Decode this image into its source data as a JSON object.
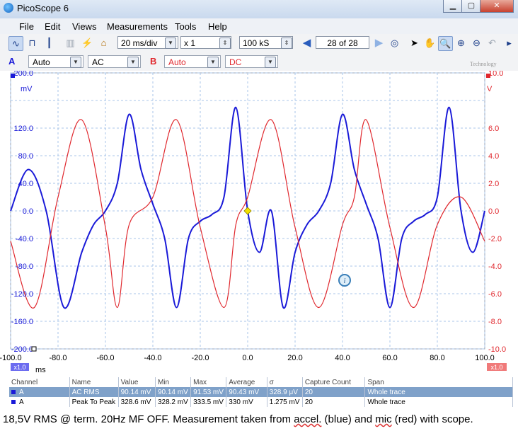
{
  "window": {
    "title": "PicoScope 6",
    "minimize": "▁",
    "maximize": "▢",
    "close": "✕"
  },
  "menu": {
    "items": [
      "File",
      "Edit",
      "Views",
      "Measurements",
      "Tools",
      "Help"
    ]
  },
  "toolbar": {
    "timebase": "20 ms/div",
    "zoom": "x 1",
    "samples": "100 kS",
    "capture": "28 of 28"
  },
  "channels": {
    "a": {
      "label": "A",
      "range": "Auto",
      "coupling": "AC",
      "color": "#1a1ad8"
    },
    "b": {
      "label": "B",
      "range": "Auto",
      "coupling": "DC",
      "color": "#e0282e"
    },
    "logo_text": "Technology"
  },
  "chart_data": {
    "type": "line",
    "x_unit": "ms",
    "y_left_unit": "mV",
    "y_right_unit": "V",
    "xlim": [
      -100,
      100
    ],
    "ylim_left": [
      -200,
      200
    ],
    "ylim_right": [
      -10,
      10
    ],
    "x_ticks": [
      "-100.0",
      "-80.0",
      "-60.0",
      "-40.0",
      "-20.0",
      "0.0",
      "20.0",
      "40.0",
      "60.0",
      "80.0",
      "100.0"
    ],
    "y_left_ticks": [
      "200.0",
      "120.0",
      "80.0",
      "40.0",
      "0.0",
      "-40.0",
      "-80.0",
      "-120.0",
      "-160.0",
      "-200.0"
    ],
    "y_right_ticks": [
      "10.0",
      "6.0",
      "4.0",
      "2.0",
      "0.0",
      "-2.0",
      "-4.0",
      "-6.0",
      "-8.0",
      "-10.0"
    ],
    "y_left_tick_values": [
      200,
      120,
      80,
      40,
      0,
      -40,
      -80,
      -120,
      -160,
      -200
    ],
    "y_right_tick_values": [
      10,
      6,
      4,
      2,
      0,
      -2,
      -4,
      -6,
      -8,
      -10
    ],
    "left_scale_label": "x1.0",
    "right_scale_label": "x1.0",
    "grid": true,
    "series": [
      {
        "color": "#1a1ad8",
        "axis": "left",
        "x": [
          -100,
          -92.5,
          -85,
          -77.5,
          -70,
          -65,
          -60,
          -55,
          -50,
          -45,
          -40,
          -35,
          -30,
          -25,
          -20,
          -15,
          -10,
          -5,
          0,
          5,
          10,
          15,
          20,
          25,
          30,
          35,
          40,
          45,
          50,
          55,
          60,
          65,
          70,
          75,
          80,
          85,
          90,
          95,
          100
        ],
        "values": [
          0,
          60,
          0,
          -140,
          -60,
          -20,
          0,
          40,
          140,
          60,
          10,
          -40,
          -140,
          -40,
          -15,
          -5,
          20,
          150,
          0,
          -60,
          0,
          -140,
          -60,
          -20,
          0,
          40,
          140,
          60,
          10,
          -40,
          -140,
          -40,
          -15,
          -5,
          20,
          150,
          0,
          -60,
          0
        ]
      },
      {
        "color": "#e0282e",
        "axis": "right",
        "x": [
          -100,
          -90,
          -80,
          -70,
          -60,
          -55,
          -50,
          -40,
          -30,
          -20,
          -10,
          -5,
          0,
          10,
          20,
          30,
          40,
          45,
          50,
          60,
          70,
          80,
          90,
          100
        ],
        "values": [
          -2.2,
          -7,
          1,
          6.6,
          -1.2,
          -7,
          -1,
          1,
          6.6,
          -1.2,
          -7,
          -1,
          1,
          6.6,
          -1.2,
          -7,
          -1,
          1,
          6.6,
          -1.2,
          -7,
          -1,
          1,
          -2.2
        ]
      }
    ],
    "markers": [
      {
        "x": 0,
        "y": 0,
        "color": "#f2e200"
      }
    ]
  },
  "measurements": {
    "columns": [
      "Channel",
      "Name",
      "Value",
      "Min",
      "Max",
      "Average",
      "σ",
      "Capture Count",
      "Span"
    ],
    "rows": [
      [
        "A",
        "AC RMS",
        "90.14 mV",
        "90.14 mV",
        "91.53 mV",
        "90.43 mV",
        "328.9 μV",
        "20",
        "Whole trace"
      ],
      [
        "A",
        "Peak To Peak",
        "328.6 mV",
        "328.2 mV",
        "333.5 mV",
        "330 mV",
        "1.275 mV",
        "20",
        "Whole trace"
      ]
    ]
  },
  "caption": {
    "prefix": "18,5V RMS @ term. 20Hz MF OFF. Measurement taken from ",
    "accel": "accel.",
    "mid": " (blue) and ",
    "mic": "mic",
    "suffix": " (red) with scope."
  }
}
